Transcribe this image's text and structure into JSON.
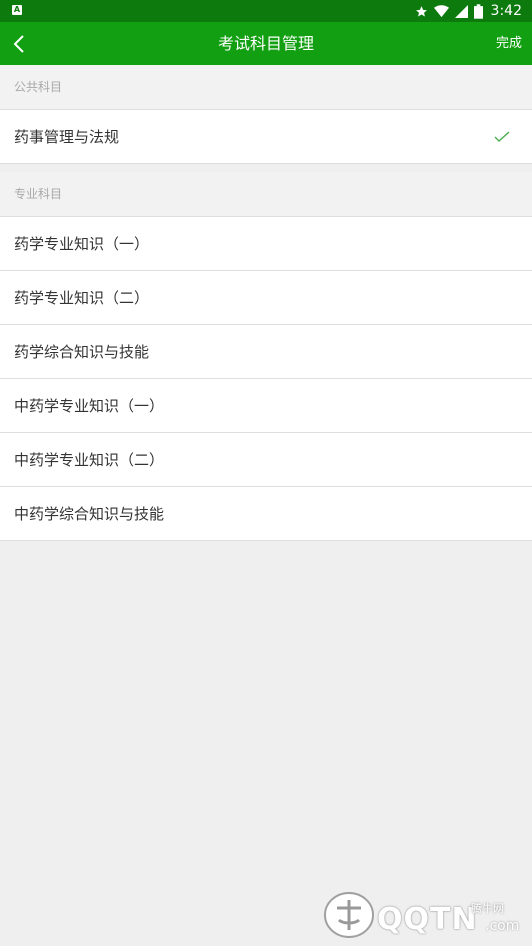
{
  "status_bar": {
    "time": "3:42",
    "icons": [
      "app-notification-icon",
      "star-icon",
      "wifi-icon",
      "signal-icon",
      "battery-icon"
    ]
  },
  "toolbar": {
    "title": "考试科目管理",
    "done_label": "完成",
    "back_icon": "chevron-left-icon",
    "background": "#12a012"
  },
  "sections": {
    "public": {
      "header": "公共科目",
      "items": [
        {
          "label": "药事管理与法规",
          "selected": true
        }
      ]
    },
    "professional": {
      "header": "专业科目",
      "items": [
        {
          "label": "药学专业知识（一）",
          "selected": false
        },
        {
          "label": "药学专业知识（二）",
          "selected": false
        },
        {
          "label": "药学综合知识与技能",
          "selected": false
        },
        {
          "label": "中药学专业知识（一）",
          "selected": false
        },
        {
          "label": "中药学专业知识（二）",
          "selected": false
        },
        {
          "label": "中药学综合知识与技能",
          "selected": false
        }
      ]
    }
  },
  "colors": {
    "accent": "#12a012",
    "status_bar": "#0c7a0c",
    "check": "#4caf50"
  },
  "watermark": {
    "brand": "QQTN",
    "sub": "腾牛网",
    "suffix": ".com"
  }
}
